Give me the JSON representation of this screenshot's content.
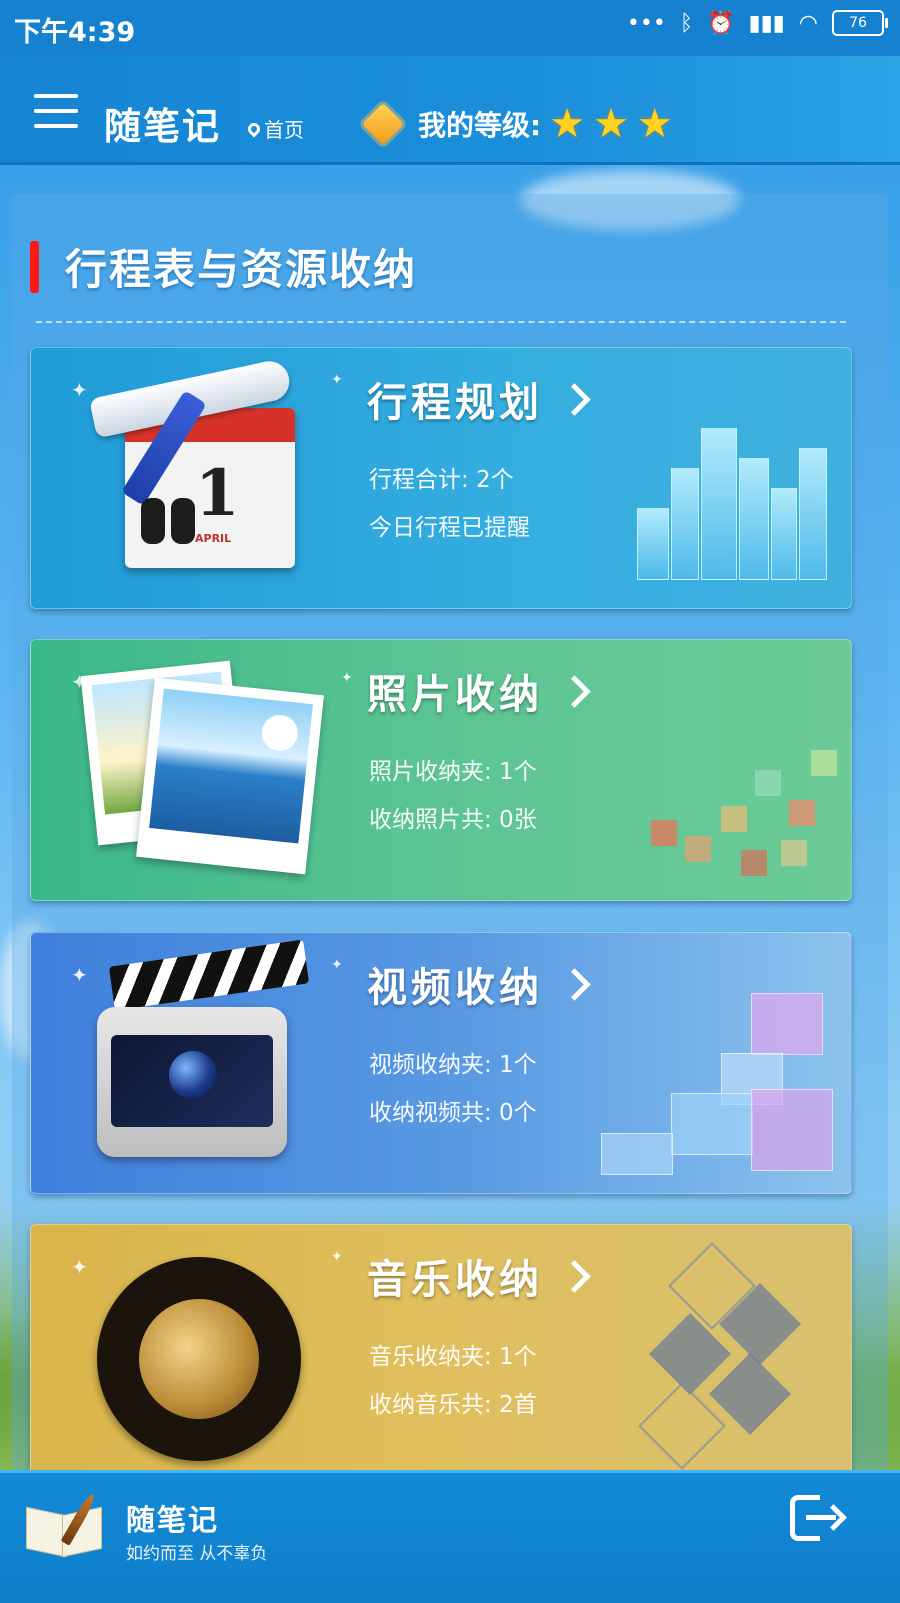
{
  "status_bar": {
    "time": "下午4:39",
    "icons": [
      "more-dots-icon",
      "bluetooth-icon",
      "alarm-icon",
      "hd-signal-icon",
      "wifi-icon"
    ],
    "battery": "76"
  },
  "header": {
    "app_title": "随笔记",
    "home_label": "首页",
    "level_label": "我的等级:",
    "level_stars": 3
  },
  "section": {
    "title": "行程表与资源收纳",
    "accent_color": "#ff1a1a"
  },
  "cards": [
    {
      "title": "行程规划",
      "line1": "行程合计: 2个",
      "line2": "今日行程已提醒",
      "calendar_day": "1",
      "calendar_month": "APRIL"
    },
    {
      "title": "照片收纳",
      "line1": "照片收纳夹: 1个",
      "line2": "收纳照片共: 0张"
    },
    {
      "title": "视频收纳",
      "line1": "视频收纳夹: 1个",
      "line2": "收纳视频共: 0个"
    },
    {
      "title": "音乐收纳",
      "line1": "音乐收纳夹: 1个",
      "line2": "收纳音乐共: 2首"
    }
  ],
  "footer": {
    "title": "随笔记",
    "slogan": "如约而至  从不辜负",
    "logout_icon": "logout-icon"
  }
}
